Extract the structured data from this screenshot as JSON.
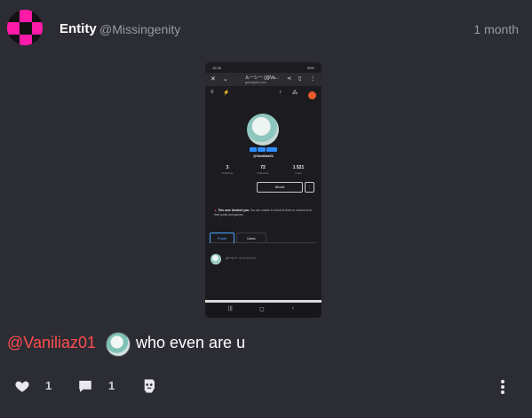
{
  "post": {
    "author_name": "Entity",
    "author_handle": "@Missingenity",
    "time": "1 month",
    "mention": "@Vaniliaz01",
    "text": "who even are u",
    "likes": "1",
    "comments": "1"
  },
  "embedded_screenshot": {
    "status_time": "16:35",
    "status_right": "59%",
    "page_title": "ルーシー (@Va...",
    "page_url": "gamejolt.com",
    "profile_handle": "@Vaniliaz01",
    "stats": [
      {
        "value": "3",
        "label": "Following"
      },
      {
        "value": "72",
        "label": "Followers"
      },
      {
        "value": "1 521",
        "label": "Likes"
      }
    ],
    "about_button": "About",
    "block_notice_bold": "This user blocked you.",
    "block_notice_rest": "You are unable to shout at them or comment on their posts and games.",
    "tabs": [
      "Posts",
      "Likes"
    ],
    "post_row_name": "ルーシー",
    "post_row_handle": "@Vaniliaz01"
  },
  "colors": {
    "background": "#2c2c34",
    "mention": "#ff4d4d",
    "avatar_pink": "#ff1aa8",
    "muted": "#9a9aa3"
  },
  "icons": {
    "like": "heart-icon",
    "comment": "comment-icon",
    "share": "share-icon",
    "more": "more-vertical-icon"
  }
}
